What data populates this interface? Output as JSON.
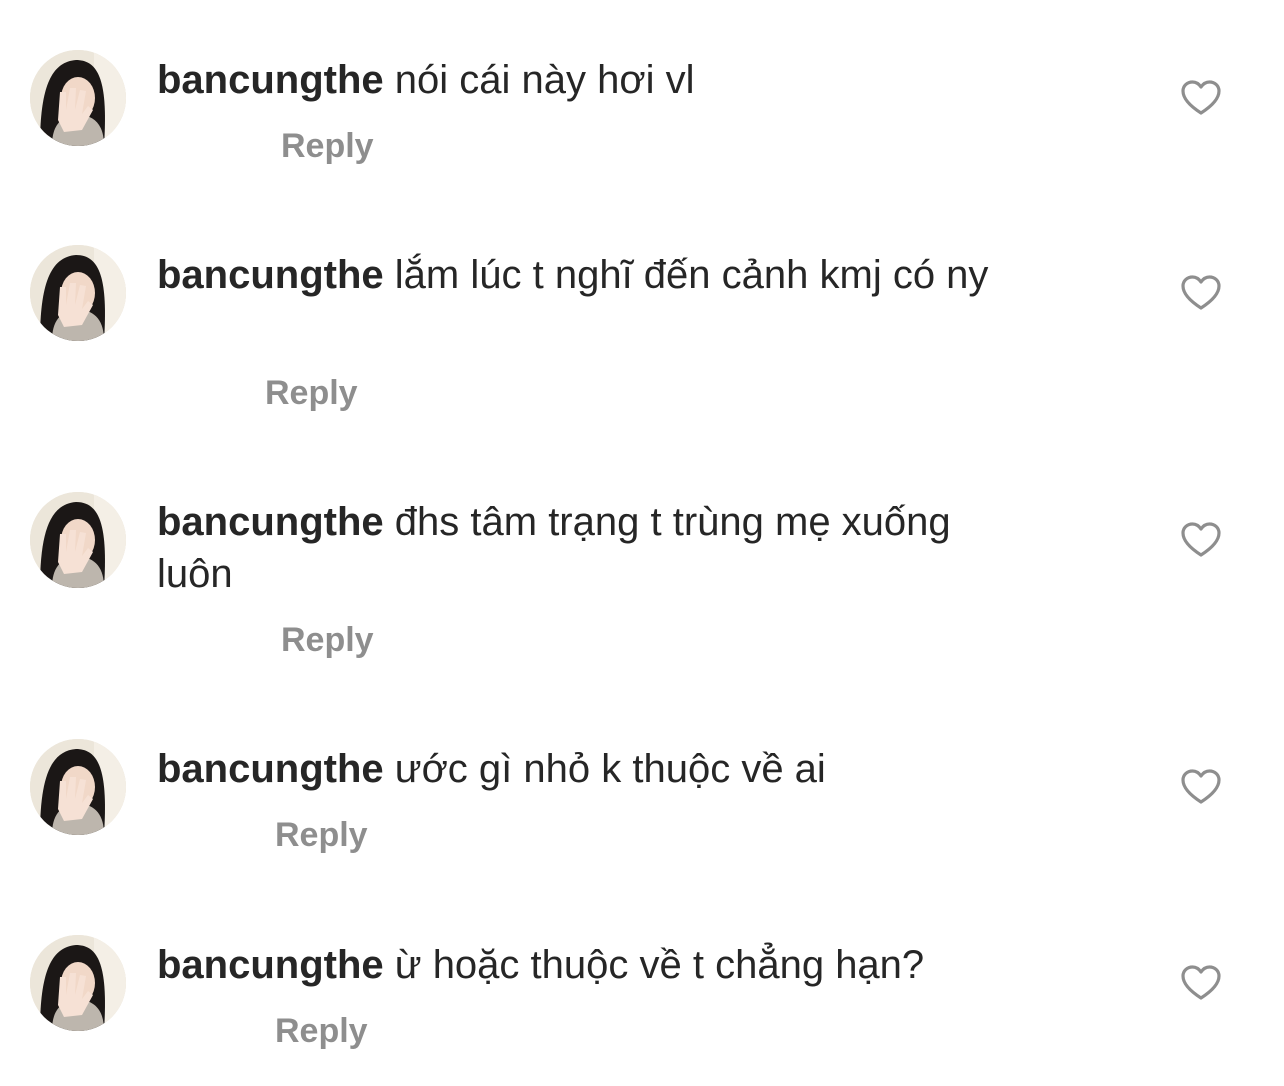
{
  "comments": [
    {
      "username": "bancungthe",
      "text": "nói cái này hơi vl",
      "reply_label": "Reply",
      "like_icon": "heart-outline-icon"
    },
    {
      "username": "bancungthe",
      "text": "lắm lúc t nghĩ đến cảnh kmj có ny",
      "reply_label": "Reply",
      "like_icon": "heart-outline-icon"
    },
    {
      "username": "bancungthe",
      "text": "đhs tâm trạng t trùng mẹ xuống luôn",
      "reply_label": "Reply",
      "like_icon": "heart-outline-icon"
    },
    {
      "username": "bancungthe",
      "text": "ước gì nhỏ k thuộc về ai",
      "reply_label": "Reply",
      "like_icon": "heart-outline-icon"
    },
    {
      "username": "bancungthe",
      "text": "ừ hoặc thuộc về t chẳng hạn?",
      "reply_label": "Reply",
      "like_icon": "heart-outline-icon"
    }
  ],
  "colors": {
    "text": "#262626",
    "secondary": "#8e8e8e",
    "background": "#ffffff"
  }
}
